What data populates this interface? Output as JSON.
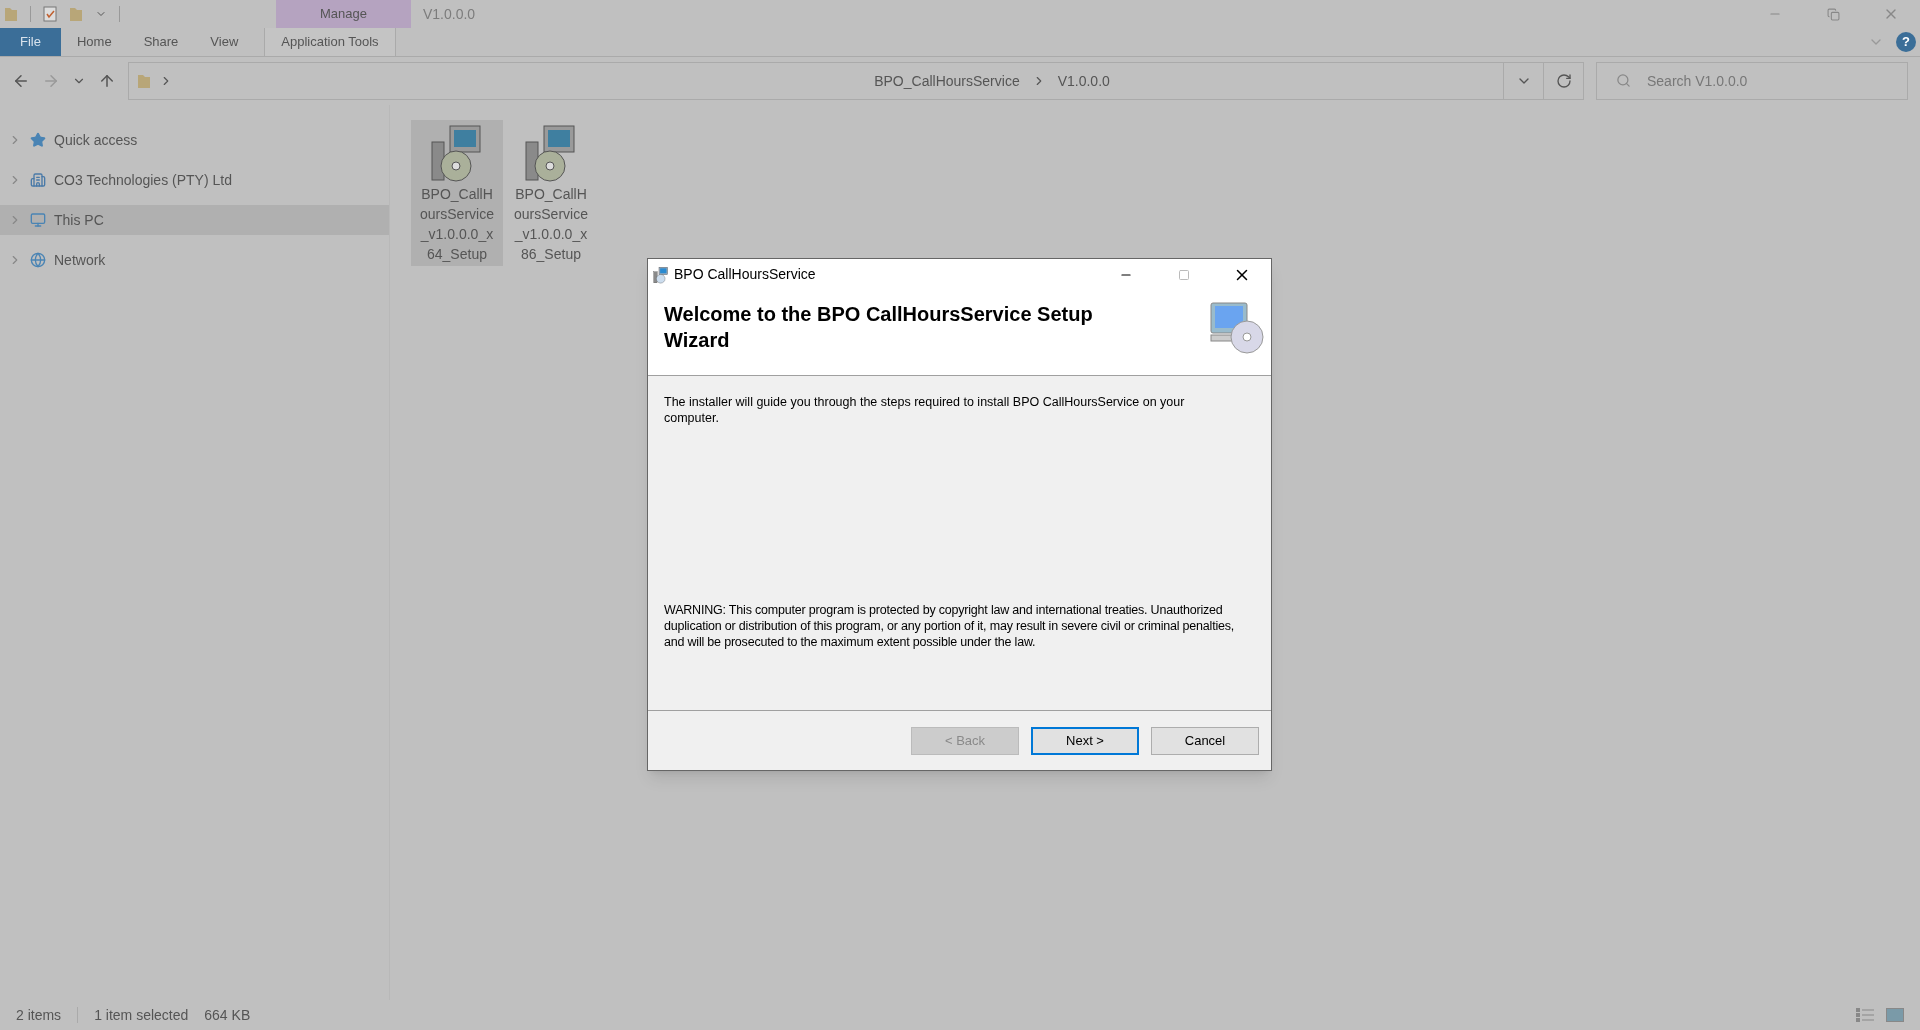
{
  "ribbon": {
    "contextual_group": "Manage",
    "window_title": "V1.0.0.0",
    "tabs": [
      {
        "label": "File",
        "kind": "file",
        "selected": false
      },
      {
        "label": "Home",
        "kind": "normal",
        "selected": false
      },
      {
        "label": "Share",
        "kind": "normal",
        "selected": false
      },
      {
        "label": "View",
        "kind": "normal",
        "selected": false
      },
      {
        "label": "Application Tools",
        "kind": "contextual",
        "selected": false
      }
    ]
  },
  "address_bar": {
    "path": [
      "BPO_CallHoursService",
      "V1.0.0.0"
    ]
  },
  "search": {
    "placeholder": "Search V1.0.0.0"
  },
  "help_glyph": "?",
  "sidebar": {
    "items": [
      {
        "label": "Quick access",
        "kind": "star",
        "selected": false
      },
      {
        "label": "CO3 Technologies (PTY) Ltd",
        "kind": "building",
        "selected": false
      },
      {
        "label": "This PC",
        "kind": "pc",
        "selected": true
      },
      {
        "label": "Network",
        "kind": "network",
        "selected": false
      }
    ]
  },
  "files": [
    {
      "name": "BPO_CallHoursService_v1.0.0.0_x64_Setup",
      "selected": true
    },
    {
      "name": "BPO_CallHoursService_v1.0.0.0_x86_Setup",
      "selected": false
    }
  ],
  "dialog": {
    "title": "BPO CallHoursService",
    "heading": "Welcome to the BPO CallHoursService Setup Wizard",
    "intro": "The installer will guide you through the steps required to install BPO CallHoursService on your computer.",
    "warning": "WARNING: This computer program is protected by copyright law and international treaties. Unauthorized duplication or distribution of this program, or any portion of it, may result in severe civil or criminal penalties, and will be prosecuted to the maximum extent possible under the law.",
    "buttons": [
      {
        "label": "< Back",
        "disabled": true,
        "focused": false
      },
      {
        "label": "Next >",
        "disabled": false,
        "focused": true
      },
      {
        "label": "Cancel",
        "disabled": false,
        "focused": false
      }
    ]
  },
  "status_bar": {
    "item_count": "2 items",
    "selection": "1 item selected",
    "size": "664 KB"
  }
}
